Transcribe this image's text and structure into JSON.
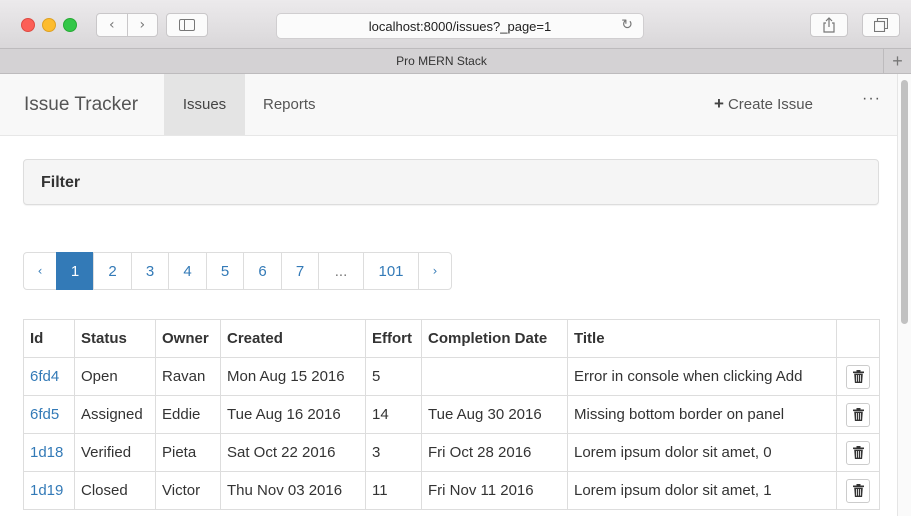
{
  "browser": {
    "url": "localhost:8000/issues?_page=1",
    "tab_title": "Pro MERN Stack",
    "back_glyph": "‹",
    "forward_glyph": "›",
    "reload_glyph": "↻",
    "new_tab_glyph": "+"
  },
  "navbar": {
    "brand": "Issue Tracker",
    "links": [
      "Issues",
      "Reports"
    ],
    "active_link": "Issues",
    "create_plus": "+",
    "create_label": "Create Issue",
    "more_label": "···"
  },
  "filter": {
    "title": "Filter"
  },
  "pagination": {
    "prev": "‹",
    "pages": [
      "1",
      "2",
      "3",
      "4",
      "5",
      "6",
      "7",
      "...",
      "101"
    ],
    "current": "1",
    "next": "›"
  },
  "table": {
    "headers": [
      "Id",
      "Status",
      "Owner",
      "Created",
      "Effort",
      "Completion Date",
      "Title",
      ""
    ],
    "rows": [
      [
        "6fd4",
        "Open",
        "Ravan",
        "Mon Aug 15 2016",
        "5",
        "",
        "Error in console when clicking Add"
      ],
      [
        "6fd5",
        "Assigned",
        "Eddie",
        "Tue Aug 16 2016",
        "14",
        "Tue Aug 30 2016",
        "Missing bottom border on panel"
      ],
      [
        "1d18",
        "Verified",
        "Pieta",
        "Sat Oct 22 2016",
        "3",
        "Fri Oct 28 2016",
        "Lorem ipsum dolor sit amet, 0"
      ],
      [
        "1d19",
        "Closed",
        "Victor",
        "Thu Nov 03 2016",
        "11",
        "Fri Nov 11 2016",
        "Lorem ipsum dolor sit amet, 1"
      ]
    ]
  },
  "colors": {
    "accent": "#337ab7",
    "navbar_bg": "#f8f8f8",
    "active_nav_bg": "#e4e4e4"
  },
  "icons": [
    "back-icon",
    "forward-icon",
    "sidebar-icon",
    "reload-icon",
    "share-icon",
    "tabs-icon",
    "plus-icon",
    "more-icon",
    "trash-icon"
  ]
}
